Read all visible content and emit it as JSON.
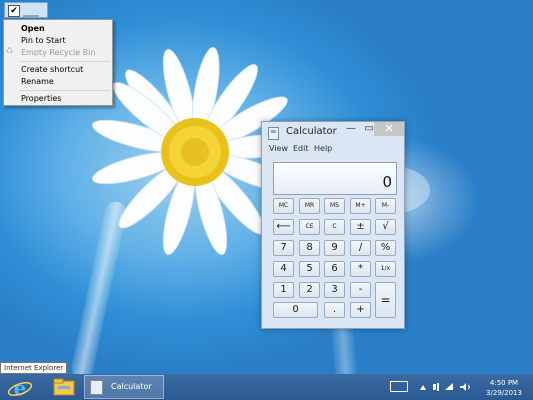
{
  "context_menu": {
    "items": [
      "Open",
      "Pin to Start",
      "Empty Recycle Bin",
      "Create shortcut",
      "Rename",
      "Properties"
    ]
  },
  "calculator": {
    "title": "Calculator",
    "menu": [
      "View",
      "Edit",
      "Help"
    ],
    "display": "0",
    "buttons": {
      "mc": "MC",
      "mr": "MR",
      "ms": "MS",
      "mplus": "M+",
      "mminus": "M-",
      "back": "⟵",
      "ce": "CE",
      "c": "C",
      "plusminus": "±",
      "sqrt": "√",
      "7": "7",
      "8": "8",
      "9": "9",
      "div": "/",
      "pct": "%",
      "4": "4",
      "5": "5",
      "6": "6",
      "mul": "*",
      "recip": "1/x",
      "1": "1",
      "2": "2",
      "3": "3",
      "minus": "-",
      "eq": "=",
      "0": "0",
      "dot": ".",
      "plus": "+"
    }
  },
  "taskbar": {
    "tooltip": "Internet Explorer",
    "calc_label": "Calculator",
    "time": "4:50 PM",
    "date": "3/29/2013"
  },
  "colors": {
    "sky": "#2f8fd6",
    "taskbar": "#2b5a93",
    "calc_frame": "#dae6f3"
  }
}
